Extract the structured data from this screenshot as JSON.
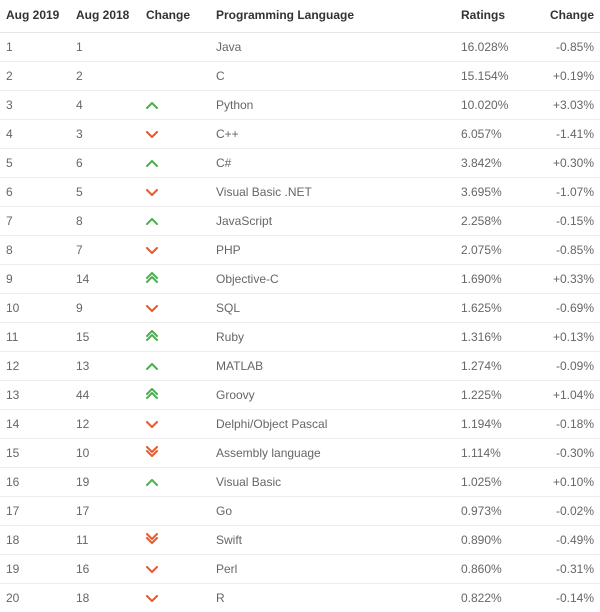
{
  "headers": {
    "rank2019": "Aug 2019",
    "rank2018": "Aug 2018",
    "changeIcon": "Change",
    "language": "Programming Language",
    "ratings": "Ratings",
    "change": "Change"
  },
  "rows": [
    {
      "rank2019": "1",
      "rank2018": "1",
      "dir": "",
      "language": "Java",
      "ratings": "16.028%",
      "change": "-0.85%"
    },
    {
      "rank2019": "2",
      "rank2018": "2",
      "dir": "",
      "language": "C",
      "ratings": "15.154%",
      "change": "+0.19%"
    },
    {
      "rank2019": "3",
      "rank2018": "4",
      "dir": "up",
      "language": "Python",
      "ratings": "10.020%",
      "change": "+3.03%"
    },
    {
      "rank2019": "4",
      "rank2018": "3",
      "dir": "down",
      "language": "C++",
      "ratings": "6.057%",
      "change": "-1.41%"
    },
    {
      "rank2019": "5",
      "rank2018": "6",
      "dir": "up",
      "language": "C#",
      "ratings": "3.842%",
      "change": "+0.30%"
    },
    {
      "rank2019": "6",
      "rank2018": "5",
      "dir": "down",
      "language": "Visual Basic .NET",
      "ratings": "3.695%",
      "change": "-1.07%"
    },
    {
      "rank2019": "7",
      "rank2018": "8",
      "dir": "up",
      "language": "JavaScript",
      "ratings": "2.258%",
      "change": "-0.15%"
    },
    {
      "rank2019": "8",
      "rank2018": "7",
      "dir": "down",
      "language": "PHP",
      "ratings": "2.075%",
      "change": "-0.85%"
    },
    {
      "rank2019": "9",
      "rank2018": "14",
      "dir": "up2",
      "language": "Objective-C",
      "ratings": "1.690%",
      "change": "+0.33%"
    },
    {
      "rank2019": "10",
      "rank2018": "9",
      "dir": "down",
      "language": "SQL",
      "ratings": "1.625%",
      "change": "-0.69%"
    },
    {
      "rank2019": "11",
      "rank2018": "15",
      "dir": "up2",
      "language": "Ruby",
      "ratings": "1.316%",
      "change": "+0.13%"
    },
    {
      "rank2019": "12",
      "rank2018": "13",
      "dir": "up",
      "language": "MATLAB",
      "ratings": "1.274%",
      "change": "-0.09%"
    },
    {
      "rank2019": "13",
      "rank2018": "44",
      "dir": "up2",
      "language": "Groovy",
      "ratings": "1.225%",
      "change": "+1.04%"
    },
    {
      "rank2019": "14",
      "rank2018": "12",
      "dir": "down",
      "language": "Delphi/Object Pascal",
      "ratings": "1.194%",
      "change": "-0.18%"
    },
    {
      "rank2019": "15",
      "rank2018": "10",
      "dir": "down2",
      "language": "Assembly language",
      "ratings": "1.114%",
      "change": "-0.30%"
    },
    {
      "rank2019": "16",
      "rank2018": "19",
      "dir": "up",
      "language": "Visual Basic",
      "ratings": "1.025%",
      "change": "+0.10%"
    },
    {
      "rank2019": "17",
      "rank2018": "17",
      "dir": "",
      "language": "Go",
      "ratings": "0.973%",
      "change": "-0.02%"
    },
    {
      "rank2019": "18",
      "rank2018": "11",
      "dir": "down2",
      "language": "Swift",
      "ratings": "0.890%",
      "change": "-0.49%"
    },
    {
      "rank2019": "19",
      "rank2018": "16",
      "dir": "down",
      "language": "Perl",
      "ratings": "0.860%",
      "change": "-0.31%"
    },
    {
      "rank2019": "20",
      "rank2018": "18",
      "dir": "down",
      "language": "R",
      "ratings": "0.822%",
      "change": "-0.14%"
    }
  ]
}
